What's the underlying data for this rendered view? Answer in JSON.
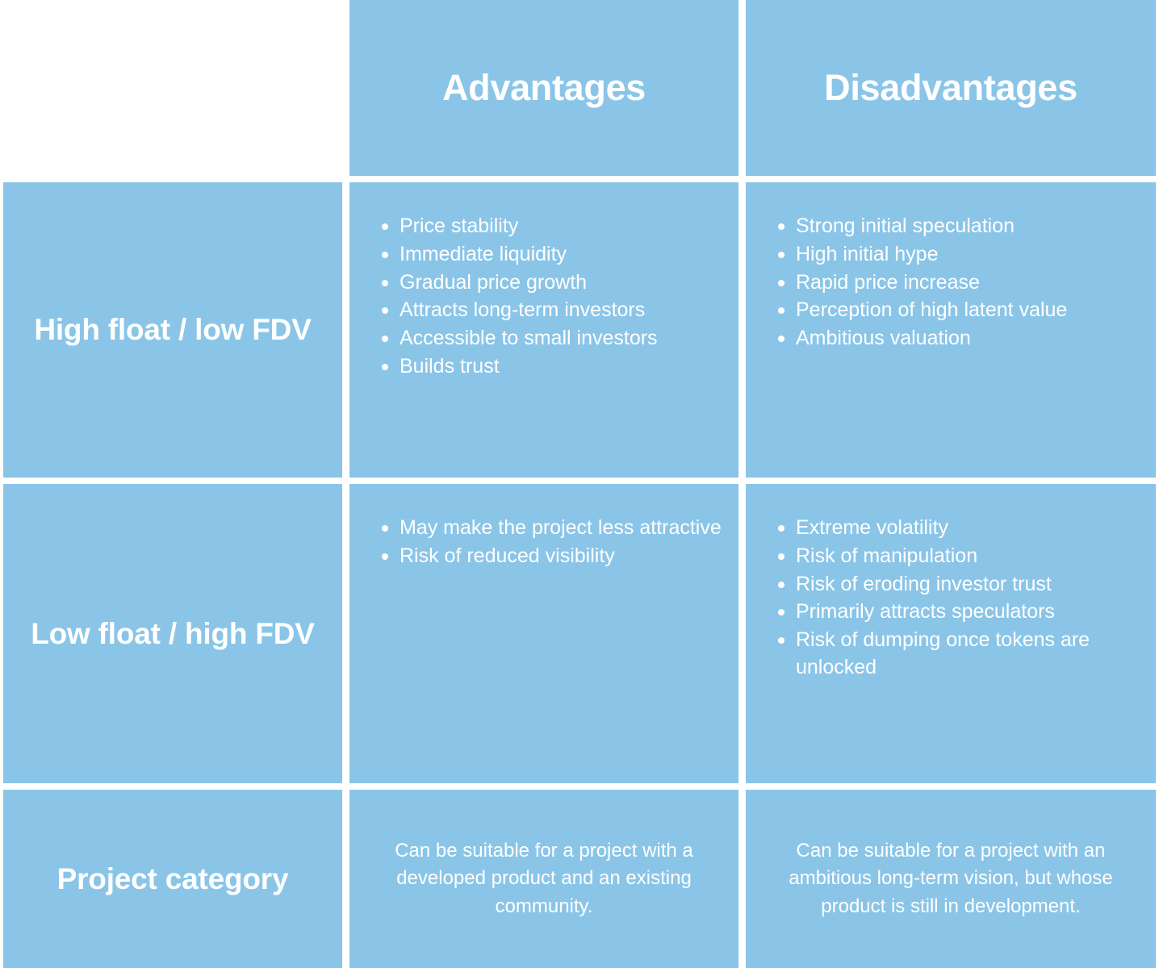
{
  "table": {
    "accent_color": "#8ac5e8",
    "text_color": "#ffffff",
    "background_color": "#ffffff",
    "corner_cell": "",
    "columns": [
      {
        "key": "advantages",
        "label": "Advantages"
      },
      {
        "key": "disadvantages",
        "label": "Disadvantages"
      }
    ],
    "rows": [
      {
        "key": "high-float-low-fdv",
        "label": "High float / low FDV",
        "advantages": [
          "Price stability",
          "Immediate liquidity",
          "Gradual price growth",
          "Attracts long-term investors",
          "Accessible to small investors",
          "Builds trust"
        ],
        "disadvantages": [
          "Strong initial speculation",
          "High initial hype",
          "Rapid price increase",
          "Perception of high latent value",
          "Ambitious valuation"
        ]
      },
      {
        "key": "low-float-high-fdv",
        "label": "Low float / high FDV",
        "advantages": [
          "May make the project less attractive",
          "Risk of reduced visibility"
        ],
        "disadvantages": [
          "Extreme volatility",
          "Risk of manipulation",
          "Risk of eroding investor trust",
          "Primarily attracts speculators",
          "Risk of dumping once tokens are unlocked"
        ]
      },
      {
        "key": "project-category",
        "label": "Project category",
        "advantages_text": "Can be suitable for a project with a developed product and an existing community.",
        "disadvantages_text": "Can be suitable for a project with an ambitious long-term vision, but whose product is still in development."
      }
    ]
  }
}
